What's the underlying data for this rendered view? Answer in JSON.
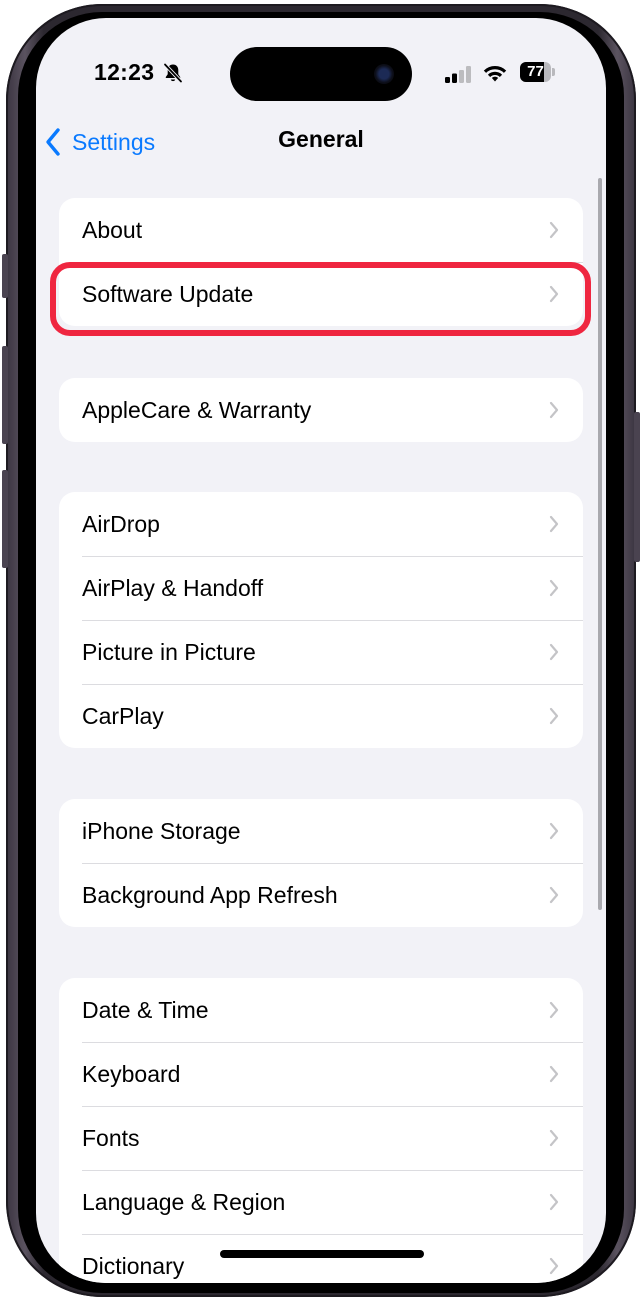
{
  "status_bar": {
    "time": "12:23",
    "silent_icon": "bell-slash-icon",
    "signal_icon": "cellular-signal-icon",
    "signal_bars_active": 2,
    "signal_bars_total": 4,
    "wifi_icon": "wifi-icon",
    "battery_level": "77",
    "battery_fraction": 0.77
  },
  "nav": {
    "back_label": "Settings",
    "back_icon": "chevron-left-icon",
    "title": "General"
  },
  "groups": [
    {
      "rows": [
        {
          "label": "About"
        },
        {
          "label": "Software Update",
          "highlighted": true
        }
      ]
    },
    {
      "rows": [
        {
          "label": "AppleCare & Warranty"
        }
      ]
    },
    {
      "rows": [
        {
          "label": "AirDrop"
        },
        {
          "label": "AirPlay & Handoff"
        },
        {
          "label": "Picture in Picture"
        },
        {
          "label": "CarPlay"
        }
      ]
    },
    {
      "rows": [
        {
          "label": "iPhone Storage"
        },
        {
          "label": "Background App Refresh"
        }
      ]
    },
    {
      "rows": [
        {
          "label": "Date & Time"
        },
        {
          "label": "Keyboard"
        },
        {
          "label": "Fonts"
        },
        {
          "label": "Language & Region"
        },
        {
          "label": "Dictionary"
        }
      ]
    }
  ],
  "row_icon": "chevron-right-icon",
  "colors": {
    "accent": "#0a7aff",
    "highlight": "#ef2640",
    "background": "#f2f2f7",
    "card": "#ffffff",
    "chevron": "#c4c4c7"
  }
}
